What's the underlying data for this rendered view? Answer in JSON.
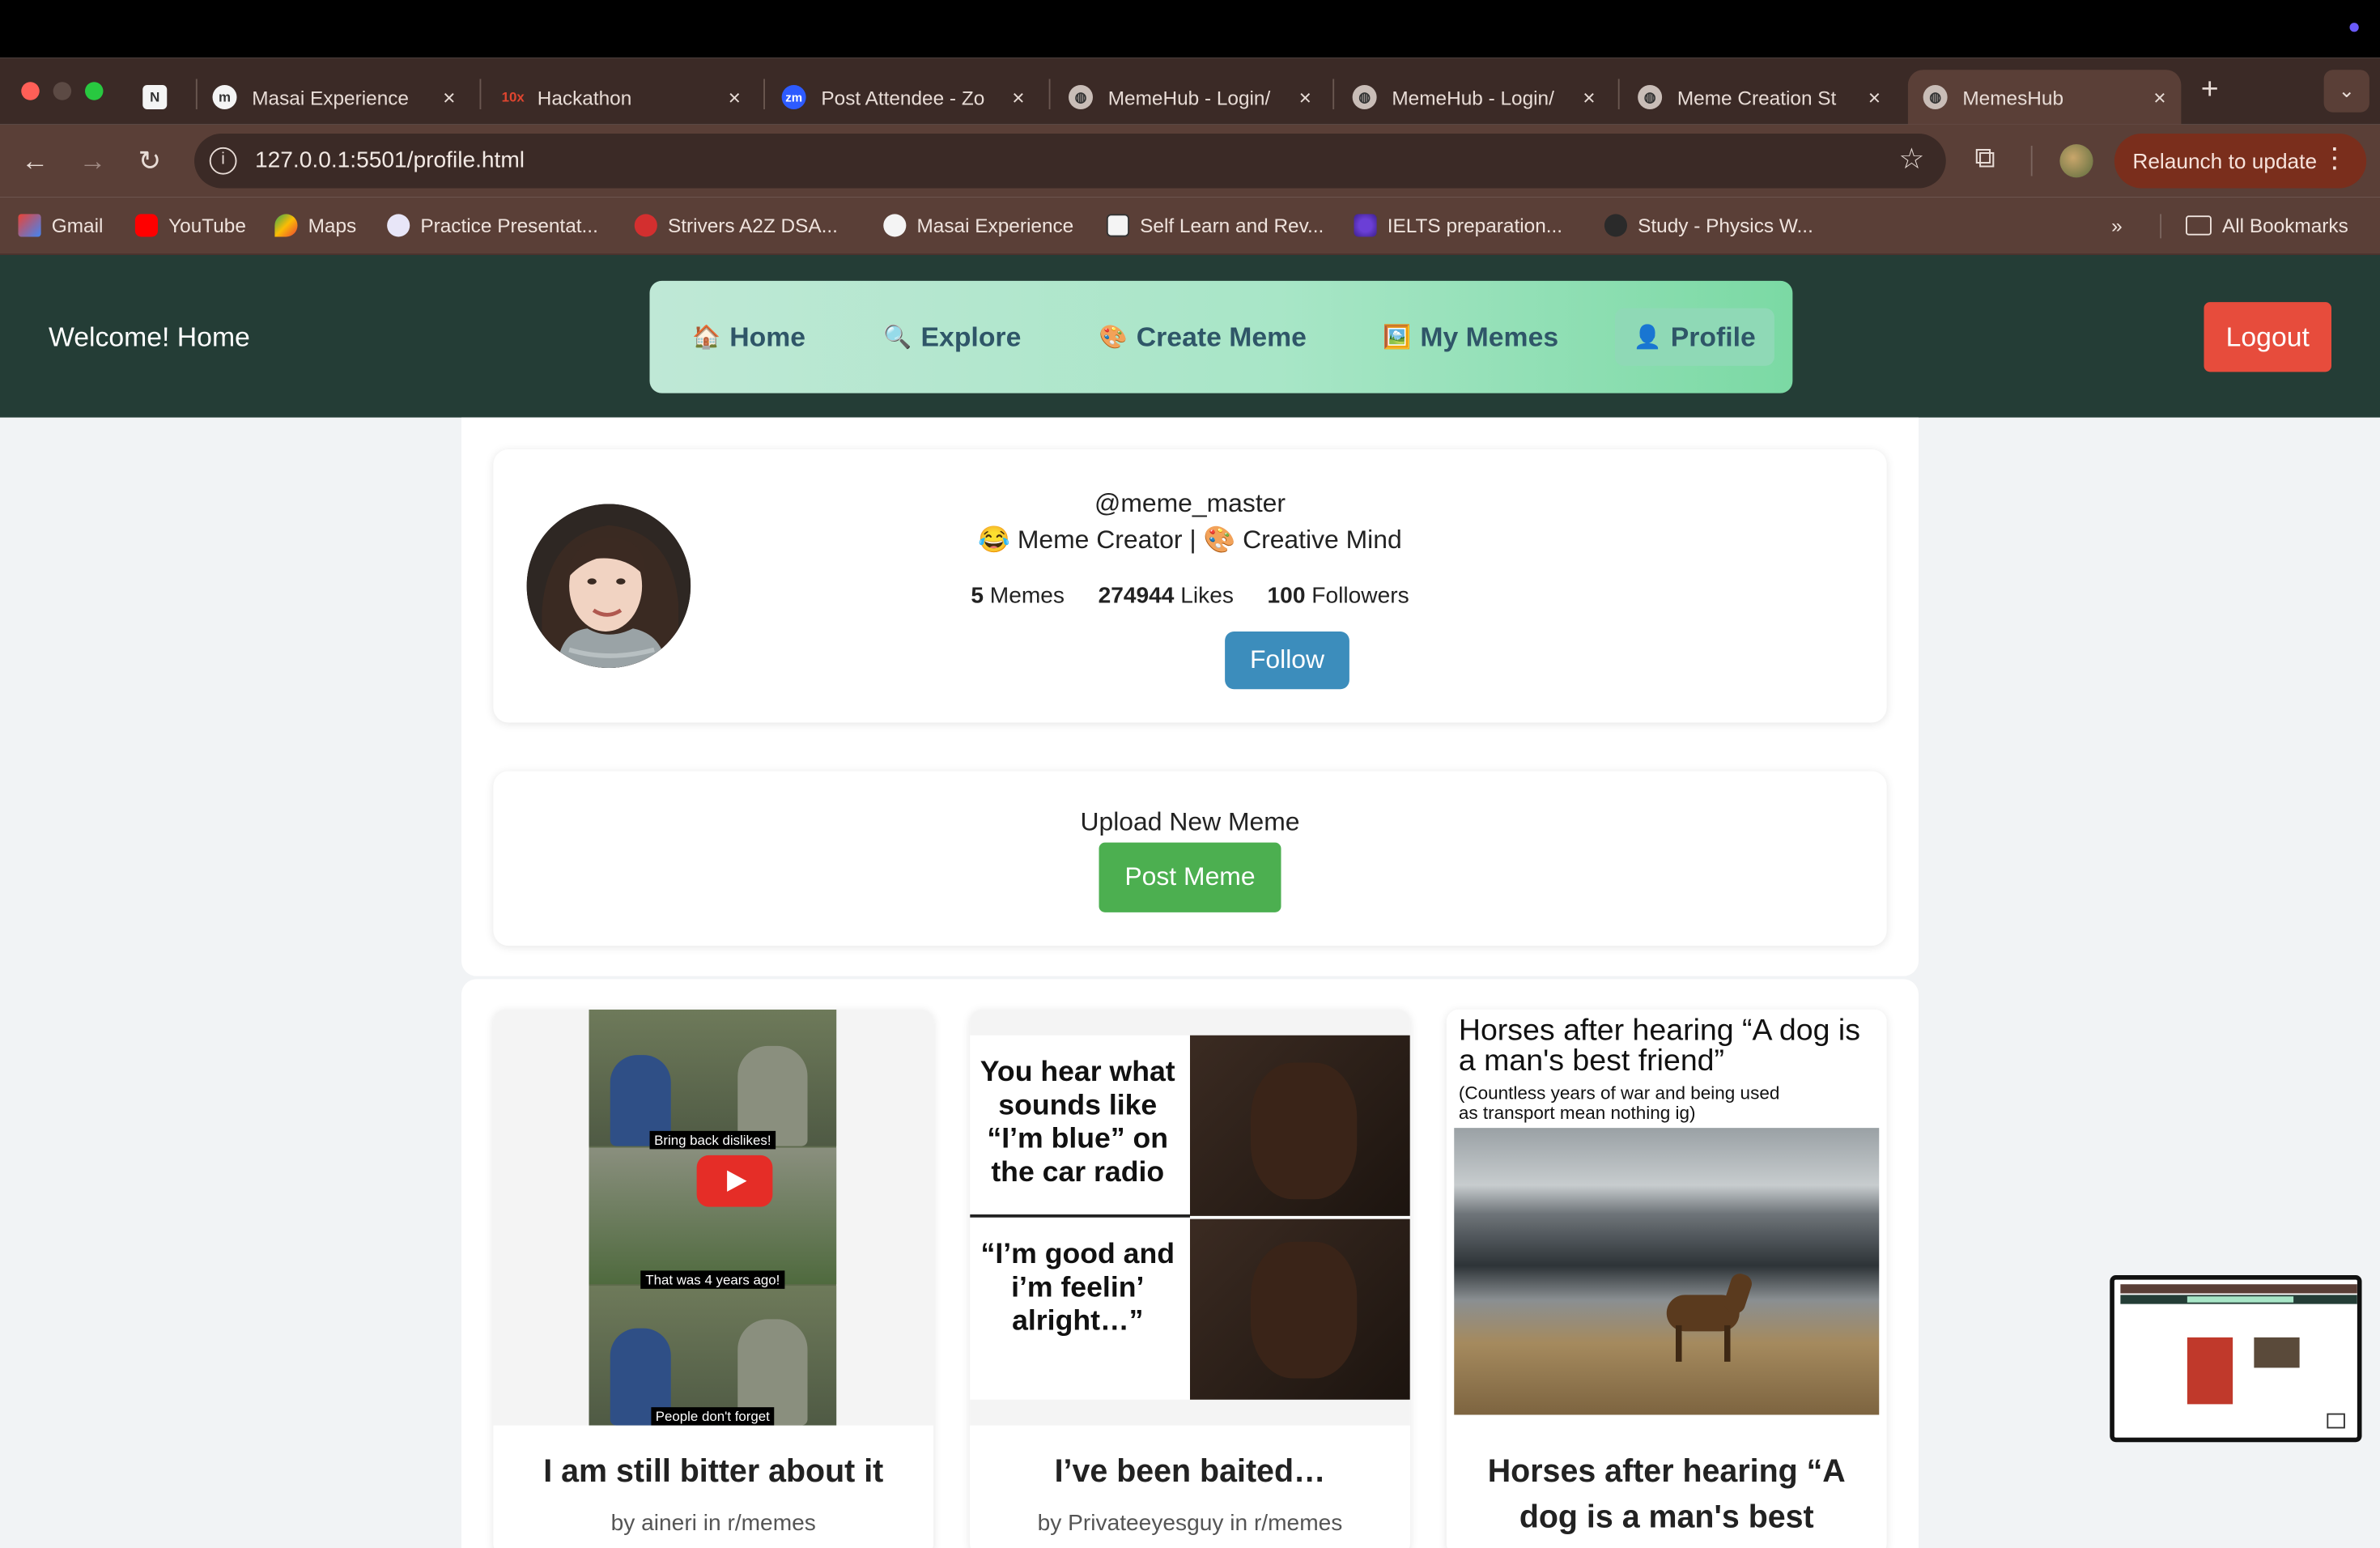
{
  "browser": {
    "tabs": [
      {
        "title": "Masai Experience",
        "icon": "masai-icon"
      },
      {
        "title": "Hackathon",
        "icon": "10x-icon"
      },
      {
        "title": "Post Attendee - Zo",
        "icon": "zoom-icon"
      },
      {
        "title": "MemeHub - Login/",
        "icon": "globe-icon"
      },
      {
        "title": "MemeHub - Login/",
        "icon": "globe-icon"
      },
      {
        "title": "Meme Creation St",
        "icon": "globe-icon"
      },
      {
        "title": "MemesHub",
        "icon": "globe-icon"
      }
    ],
    "url": "127.0.0.1:5501/profile.html",
    "relaunch_label": "Relaunch to update",
    "bookmarks": [
      "Gmail",
      "YouTube",
      "Maps",
      "Practice Presentat...",
      "Strivers A2Z DSA...",
      "Masai Experience",
      "Self Learn and Rev...",
      "IELTS preparation...",
      "Study - Physics W..."
    ],
    "all_bookmarks": "All Bookmarks",
    "icons": {
      "close": "×",
      "new_tab": "+",
      "chevron": "»"
    },
    "colors": {
      "tabstrip": "#3b2a26",
      "toolbar": "#5a3f37",
      "relaunch": "#7a2e1c"
    }
  },
  "header": {
    "welcome": "Welcome! Home",
    "nav": [
      {
        "label": "Home",
        "icon": "🏠"
      },
      {
        "label": "Explore",
        "icon": "🔍"
      },
      {
        "label": "Create Meme",
        "icon": "🎨"
      },
      {
        "label": "My Memes",
        "icon": "🖼️"
      },
      {
        "label": "Profile",
        "icon": "👤"
      }
    ],
    "logout": "Logout",
    "colors": {
      "background": "#243d36",
      "logout": "#e74c3c"
    }
  },
  "profile": {
    "username": "@meme_master",
    "bio": "😂 Meme Creator | 🎨 Creative Mind",
    "memes_count": "5",
    "memes_label": "Memes",
    "likes_count": "274944",
    "likes_label": "Likes",
    "followers_count": "100",
    "followers_label": "Followers",
    "follow_label": "Follow"
  },
  "upload": {
    "title": "Upload New Meme",
    "button": "Post Meme"
  },
  "memes": [
    {
      "title": "I am still bitter about it",
      "byline": "by aineri in r/memes",
      "captions": [
        "Bring back dislikes!",
        "That was 4 years ago!",
        "People don't forget"
      ]
    },
    {
      "title": "I’ve been baited…",
      "byline": "by Privateeyesguy in r/memes",
      "captions": [
        "You hear what sounds like “I’m blue” on the car radio",
        "“I’m good and i’m feelin’ alright…”"
      ]
    },
    {
      "title": "Horses after hearing “A dog is a man's best",
      "byline": "",
      "captions": [
        "Horses after hearing “A dog is a man's best friend”",
        "(Countless years of war and being used as transport mean nothing ig)"
      ]
    }
  ]
}
